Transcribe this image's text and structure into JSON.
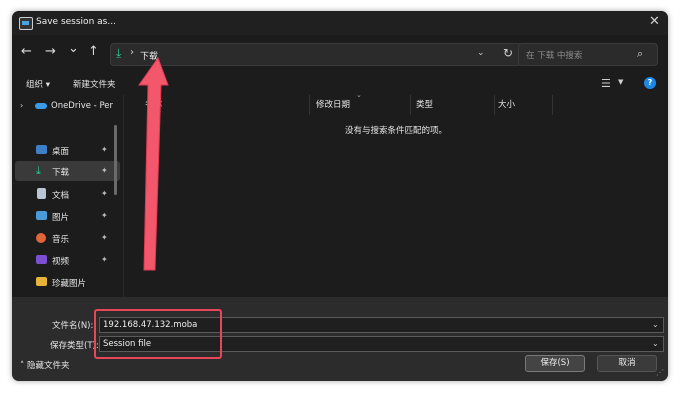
{
  "window": {
    "title": "Save session as..."
  },
  "nav": {
    "back": "←",
    "forward": "→",
    "down": "⌄",
    "up": "↑"
  },
  "address": {
    "current_folder": "下载"
  },
  "search": {
    "placeholder": "在 下载 中搜索"
  },
  "toolbar": {
    "organize_label": "组织 ▾",
    "new_folder_label": "新建文件夹"
  },
  "sidebar": {
    "onedrive": "OneDrive - Per",
    "items": [
      {
        "label": "桌面",
        "pinned": true
      },
      {
        "label": "下载",
        "pinned": true,
        "selected": true
      },
      {
        "label": "文档",
        "pinned": true
      },
      {
        "label": "图片",
        "pinned": true
      },
      {
        "label": "音乐",
        "pinned": true
      },
      {
        "label": "视频",
        "pinned": true
      },
      {
        "label": "珍藏图片",
        "pinned": false
      }
    ]
  },
  "columns": {
    "name": "名称",
    "modified": "修改日期",
    "type": "类型",
    "size": "大小"
  },
  "empty_message": "没有与搜索条件匹配的项。",
  "form": {
    "filename_label": "文件名(N):",
    "filename_value": "192.168.47.132.moba",
    "filetype_label": "保存类型(T):",
    "filetype_value": "Session file"
  },
  "footer": {
    "hide_folders_label": "隐藏文件夹",
    "save_label": "保存(S)",
    "cancel_label": "取消"
  },
  "colors": {
    "highlight": "#e8465a",
    "accent": "#2ecc9a",
    "help": "#1e88e5"
  },
  "icons": [
    "close-icon",
    "back-icon",
    "forward-icon",
    "recent-icon",
    "up-icon",
    "download-icon",
    "refresh-icon",
    "search-icon",
    "view-icon",
    "help-icon",
    "pin-icon",
    "onedrive-icon",
    "annotation-arrow"
  ]
}
